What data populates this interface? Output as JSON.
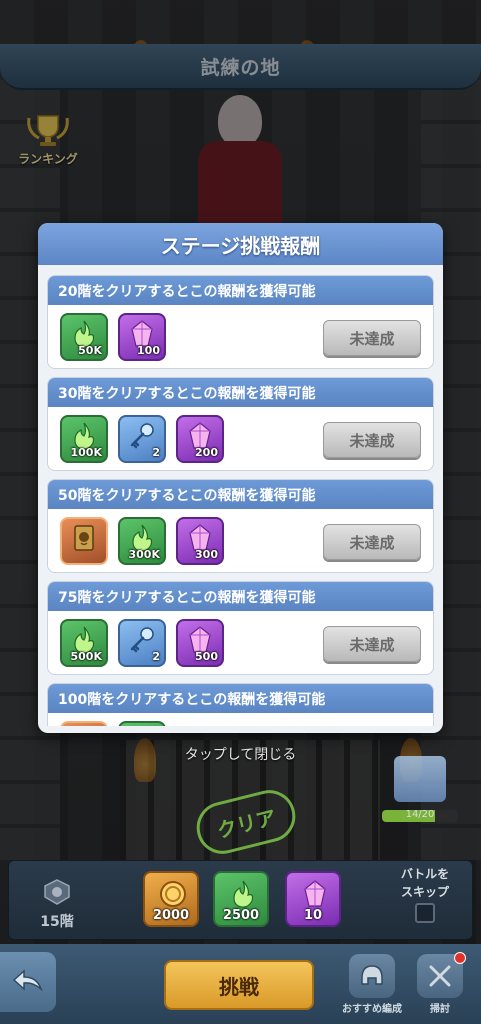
{
  "header": {
    "title": "試練の地"
  },
  "ranking": {
    "label": "ランキング"
  },
  "modal": {
    "title": "ステージ挑戦報酬",
    "rewards": [
      {
        "caption": "20階をクリアするとこの報酬を獲得可能",
        "items": [
          {
            "icon": "green-flame-icon",
            "qty": "50K"
          },
          {
            "icon": "purple-crystal-icon",
            "qty": "100"
          }
        ],
        "status": "未達成"
      },
      {
        "caption": "30階をクリアするとこの報酬を獲得可能",
        "items": [
          {
            "icon": "green-flame-icon",
            "qty": "100K"
          },
          {
            "icon": "blue-key-icon",
            "qty": "2"
          },
          {
            "icon": "purple-crystal-icon",
            "qty": "200"
          }
        ],
        "status": "未達成"
      },
      {
        "caption": "50階をクリアするとこの報酬を獲得可能",
        "items": [
          {
            "icon": "gold-card-icon",
            "qty": ""
          },
          {
            "icon": "green-flame-icon",
            "qty": "300K"
          },
          {
            "icon": "purple-crystal-icon",
            "qty": "300"
          }
        ],
        "status": "未達成"
      },
      {
        "caption": "75階をクリアするとこの報酬を獲得可能",
        "items": [
          {
            "icon": "green-flame-icon",
            "qty": "500K"
          },
          {
            "icon": "blue-key-icon",
            "qty": "2"
          },
          {
            "icon": "purple-crystal-icon",
            "qty": "500"
          }
        ],
        "status": "未達成"
      },
      {
        "caption": "100階をクリアするとこの報酬を獲得可能"
      }
    ]
  },
  "tap_to_close": "タップして閉じる",
  "stage": {
    "clear_stamp": "クリア",
    "chest_progress": "14/20",
    "chest_fraction": 0.7
  },
  "info_bar": {
    "floor": "15階",
    "costs": [
      {
        "icon": "gold-coin-icon",
        "value": "2000",
        "color": "#d89a3a"
      },
      {
        "icon": "green-flame-icon",
        "value": "2500",
        "color": "#3f9a4c"
      },
      {
        "icon": "purple-crystal-icon",
        "value": "10",
        "color": "#8a3dbf"
      }
    ],
    "skip_label_1": "バトルを",
    "skip_label_2": "スキップ"
  },
  "nav": {
    "challenge": "挑戦",
    "recommended": "おすすめ編成",
    "sweep": "掃討"
  }
}
